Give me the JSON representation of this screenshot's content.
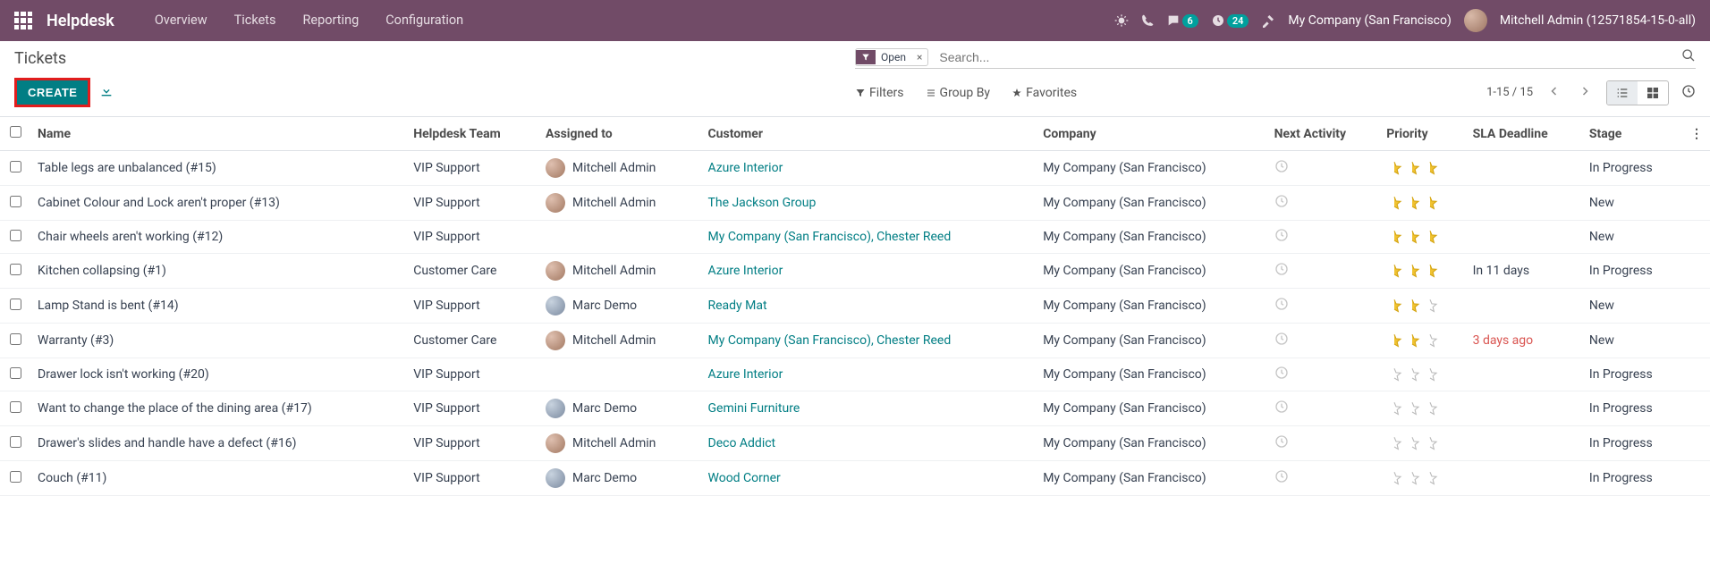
{
  "nav": {
    "brand": "Helpdesk",
    "menu": [
      "Overview",
      "Tickets",
      "Reporting",
      "Configuration"
    ],
    "msg_badge": "6",
    "act_badge": "24",
    "company": "My Company (San Francisco)",
    "user": "Mitchell Admin (12571854-15-0-all)"
  },
  "cp": {
    "breadcrumb": "Tickets",
    "create": "CREATE",
    "facet": "Open",
    "search_placeholder": "Search...",
    "filters": "Filters",
    "groupby": "Group By",
    "favorites": "Favorites",
    "pager": "1-15 / 15"
  },
  "columns": {
    "name": "Name",
    "team": "Helpdesk Team",
    "assigned": "Assigned to",
    "customer": "Customer",
    "company": "Company",
    "activity": "Next Activity",
    "priority": "Priority",
    "sla": "SLA Deadline",
    "stage": "Stage"
  },
  "rows": [
    {
      "name": "Table legs are unbalanced (#15)",
      "team": "VIP Support",
      "assigned": "Mitchell Admin",
      "avatar": "v1",
      "customer": "Azure Interior",
      "company": "My Company (San Francisco)",
      "priority": 3,
      "sla": "",
      "sla_late": false,
      "stage": "In Progress"
    },
    {
      "name": "Cabinet Colour and Lock aren't proper (#13)",
      "team": "VIP Support",
      "assigned": "Mitchell Admin",
      "avatar": "v1",
      "customer": "The Jackson Group",
      "company": "My Company (San Francisco)",
      "priority": 3,
      "sla": "",
      "sla_late": false,
      "stage": "New"
    },
    {
      "name": "Chair wheels aren't working (#12)",
      "team": "VIP Support",
      "assigned": "",
      "avatar": "",
      "customer": "My Company (San Francisco), Chester Reed",
      "company": "My Company (San Francisco)",
      "priority": 3,
      "sla": "",
      "sla_late": false,
      "stage": "New"
    },
    {
      "name": "Kitchen collapsing (#1)",
      "team": "Customer Care",
      "assigned": "Mitchell Admin",
      "avatar": "v1",
      "customer": "Azure Interior",
      "company": "My Company (San Francisco)",
      "priority": 3,
      "sla": "In 11 days",
      "sla_late": false,
      "stage": "In Progress"
    },
    {
      "name": "Lamp Stand is bent (#14)",
      "team": "VIP Support",
      "assigned": "Marc Demo",
      "avatar": "v2",
      "customer": "Ready Mat",
      "company": "My Company (San Francisco)",
      "priority": 2,
      "sla": "",
      "sla_late": false,
      "stage": "New"
    },
    {
      "name": "Warranty (#3)",
      "team": "Customer Care",
      "assigned": "Mitchell Admin",
      "avatar": "v1",
      "customer": "My Company (San Francisco), Chester Reed",
      "company": "My Company (San Francisco)",
      "priority": 2,
      "sla": "3 days ago",
      "sla_late": true,
      "stage": "New"
    },
    {
      "name": "Drawer lock isn't working (#20)",
      "team": "VIP Support",
      "assigned": "",
      "avatar": "",
      "customer": "Azure Interior",
      "company": "My Company (San Francisco)",
      "priority": 0,
      "sla": "",
      "sla_late": false,
      "stage": "In Progress"
    },
    {
      "name": "Want to change the place of the dining area (#17)",
      "team": "VIP Support",
      "assigned": "Marc Demo",
      "avatar": "v2",
      "customer": "Gemini Furniture",
      "company": "My Company (San Francisco)",
      "priority": 0,
      "sla": "",
      "sla_late": false,
      "stage": "In Progress"
    },
    {
      "name": "Drawer's slides and handle have a defect (#16)",
      "team": "VIP Support",
      "assigned": "Mitchell Admin",
      "avatar": "v1",
      "customer": "Deco Addict",
      "company": "My Company (San Francisco)",
      "priority": 0,
      "sla": "",
      "sla_late": false,
      "stage": "In Progress"
    },
    {
      "name": "Couch (#11)",
      "team": "VIP Support",
      "assigned": "Marc Demo",
      "avatar": "v2",
      "customer": "Wood Corner",
      "company": "My Company (San Francisco)",
      "priority": 0,
      "sla": "",
      "sla_late": false,
      "stage": "In Progress"
    }
  ]
}
